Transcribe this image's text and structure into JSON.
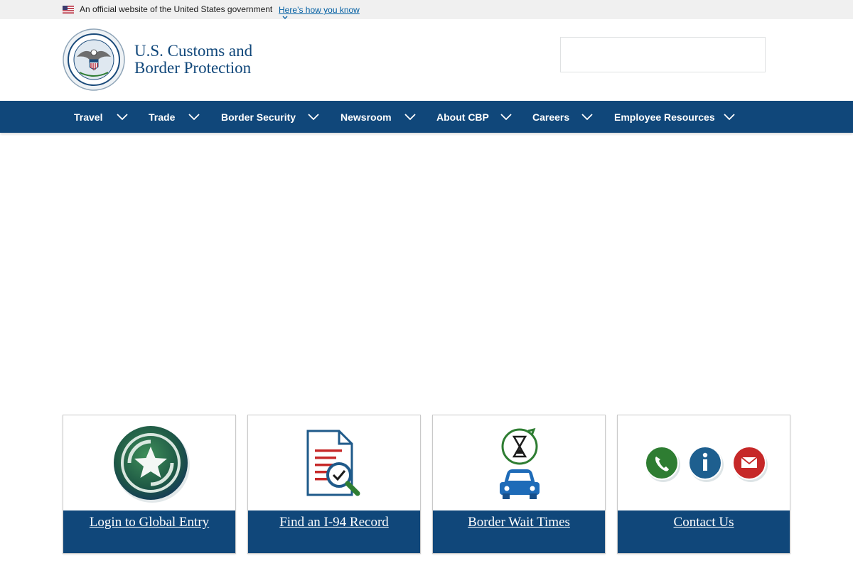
{
  "gov_banner": {
    "text": "An official website of the United States government",
    "link_label": "Here’s how you know"
  },
  "header": {
    "logo_line1": "U.S. Customs and",
    "logo_line2": "Border Protection",
    "search_placeholder": ""
  },
  "nav": {
    "items": [
      {
        "label": "Travel"
      },
      {
        "label": "Trade"
      },
      {
        "label": "Border Security"
      },
      {
        "label": "Newsroom"
      },
      {
        "label": "About CBP"
      },
      {
        "label": "Careers"
      },
      {
        "label": "Employee Resources"
      }
    ]
  },
  "cards": [
    {
      "label": "Login to Global Entry",
      "icon": "global-entry-star-icon"
    },
    {
      "label": "Find an I-94 Record",
      "icon": "document-search-icon"
    },
    {
      "label": "Border Wait Times",
      "icon": "hourglass-car-icon"
    },
    {
      "label": "Contact Us",
      "icon": "phone-info-mail-icon"
    }
  ],
  "colors": {
    "brand_blue": "#10477a",
    "banner_bg": "#f0f0f0",
    "link_blue": "#005ea2",
    "green": "#2e7d32"
  }
}
